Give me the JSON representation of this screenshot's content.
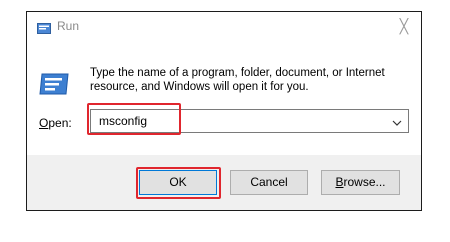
{
  "window": {
    "title": "Run",
    "close_glyph": "╳",
    "description": "Type the name of a program, folder, document, or Internet resource, and Windows will open it for you.",
    "open_label_accel": "O",
    "open_label_rest": "pen:",
    "input_value": "msconfig",
    "title_icon": "run-icon",
    "dialog_icon": "run-icon"
  },
  "buttons": {
    "ok": "OK",
    "cancel": "Cancel",
    "browse_accel": "B",
    "browse_rest": "rowse..."
  },
  "colors": {
    "highlight": "#e0262e",
    "accent": "#0078d7",
    "icon_blue": "#2f6fbf"
  }
}
